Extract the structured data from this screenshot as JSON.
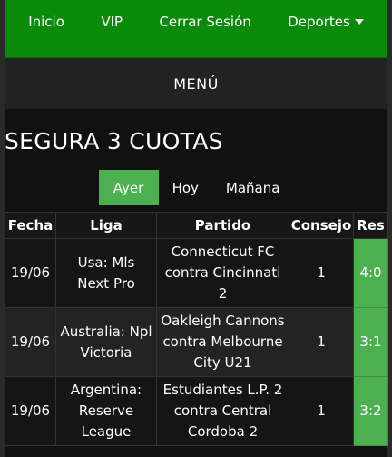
{
  "nav": {
    "items": [
      "Inicio",
      "VIP",
      "Cerrar Sesión"
    ],
    "dropdown": "Deportes"
  },
  "menu_label": "MENÚ",
  "page_title": "SEGURA 3 CUOTAS",
  "tabs": [
    {
      "label": "Ayer",
      "active": true
    },
    {
      "label": "Hoy",
      "active": false
    },
    {
      "label": "Mañana",
      "active": false
    }
  ],
  "table": {
    "headers": [
      "Fecha",
      "Liga",
      "Partido",
      "Consejo",
      "Res"
    ],
    "rows": [
      {
        "date": "19/06",
        "league": "Usa: Mls Next Pro",
        "match": "Connecticut FC contra Cincinnati 2",
        "tip": "1",
        "result": "4:0"
      },
      {
        "date": "19/06",
        "league": "Australia: Npl Victoria",
        "match": "Oakleigh Cannons contra Melbourne City U21",
        "tip": "1",
        "result": "3:1"
      },
      {
        "date": "19/06",
        "league": "Argentina: Reserve League",
        "match": "Estudiantes L.P. 2 contra Central Cordoba 2",
        "tip": "1",
        "result": "3:2"
      }
    ]
  },
  "colors": {
    "nav_green": "#0b8a0b",
    "accent_green": "#4caf50",
    "background": "#111111"
  }
}
